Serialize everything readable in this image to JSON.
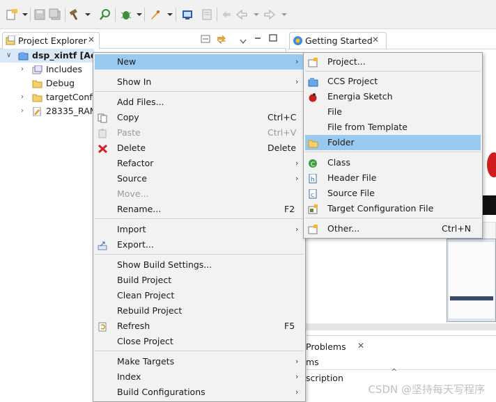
{
  "project_explorer": {
    "tab_label": "Project Explorer",
    "tree": [
      {
        "label": "dsp_xintf  [Ac",
        "expanded": true,
        "icon": "project-icon"
      },
      {
        "label": "Includes",
        "icon": "includes-icon"
      },
      {
        "label": "Debug",
        "icon": "folder-icon"
      },
      {
        "label": "targetConfi",
        "icon": "folder-icon"
      },
      {
        "label": "28335_RAM",
        "icon": "file-icon"
      }
    ]
  },
  "getting_started": {
    "tab_label": "Getting Started"
  },
  "problems": {
    "tab_label": "Problems",
    "row1": "ms",
    "row2": "scription"
  },
  "context_menu": {
    "items": {
      "new": "New",
      "show_in": "Show In",
      "add_files": "Add Files...",
      "copy": "Copy",
      "copy_acc": "Ctrl+C",
      "paste": "Paste",
      "paste_acc": "Ctrl+V",
      "delete": "Delete",
      "delete_acc": "Delete",
      "refactor": "Refactor",
      "source": "Source",
      "move": "Move...",
      "rename": "Rename...",
      "rename_acc": "F2",
      "import": "Import",
      "export": "Export...",
      "show_build_settings": "Show Build Settings...",
      "build_project": "Build Project",
      "clean_project": "Clean Project",
      "rebuild_project": "Rebuild Project",
      "refresh": "Refresh",
      "refresh_acc": "F5",
      "close_project": "Close Project",
      "make_targets": "Make Targets",
      "index": "Index",
      "build_configurations": "Build Configurations"
    }
  },
  "new_submenu": {
    "items": {
      "project": "Project...",
      "ccs_project": "CCS Project",
      "energia_sketch": "Energia Sketch",
      "file": "File",
      "file_from_template": "File from Template",
      "folder": "Folder",
      "class": "Class",
      "header_file": "Header File",
      "source_file": "Source File",
      "target_configuration_file": "Target Configuration File",
      "other": "Other...",
      "other_acc": "Ctrl+N"
    }
  },
  "watermark": "CSDN @坚持每天写程序",
  "colors": {
    "highlight": "#99c9ef",
    "menu_bg": "#f2f2f2"
  }
}
